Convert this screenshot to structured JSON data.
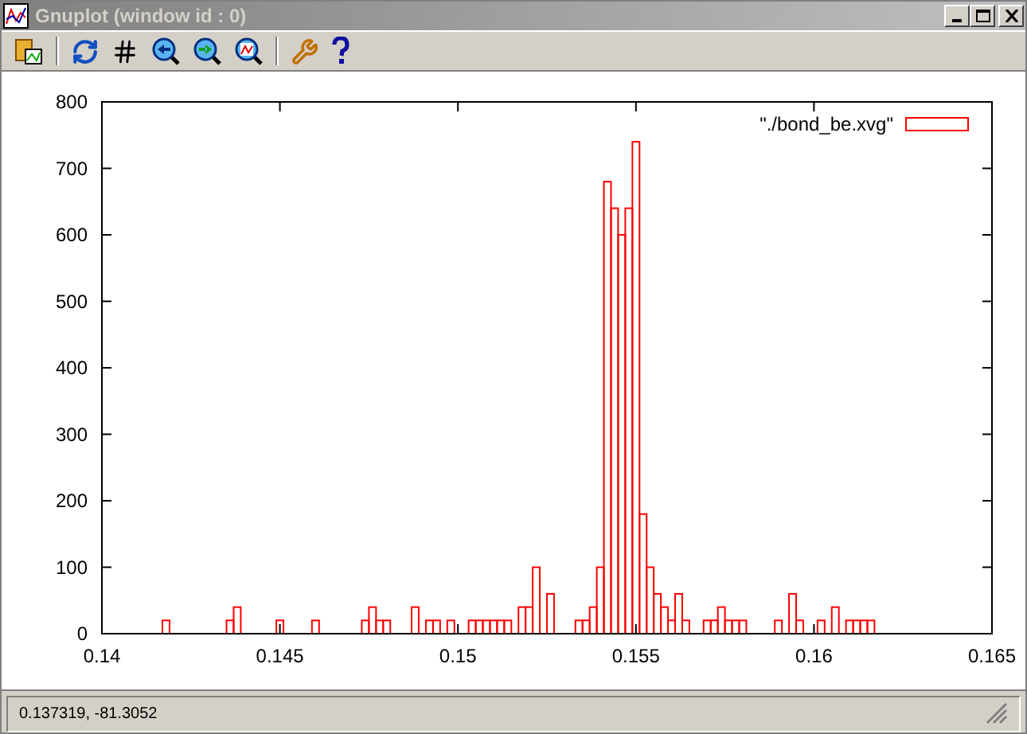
{
  "window": {
    "title": "Gnuplot (window id : 0)"
  },
  "plot": {
    "chart_data": {
      "type": "bar",
      "xlim": [
        0.14,
        0.165
      ],
      "ylim": [
        0,
        800
      ],
      "xticks": [
        0.14,
        0.145,
        0.15,
        0.155,
        0.16,
        0.165
      ],
      "yticks": [
        0,
        100,
        200,
        300,
        400,
        500,
        600,
        700,
        800
      ],
      "x": [
        0.1418,
        0.1436,
        0.1438,
        0.145,
        0.146,
        0.1474,
        0.1476,
        0.1478,
        0.148,
        0.1488,
        0.1492,
        0.1494,
        0.1498,
        0.1504,
        0.1506,
        0.1508,
        0.151,
        0.1512,
        0.1514,
        0.1518,
        0.152,
        0.1522,
        0.1526,
        0.1534,
        0.1536,
        0.1538,
        0.154,
        0.1542,
        0.1544,
        0.1546,
        0.1548,
        0.155,
        0.1552,
        0.1554,
        0.1556,
        0.1558,
        0.156,
        0.1562,
        0.1564,
        0.157,
        0.1572,
        0.1574,
        0.1576,
        0.1578,
        0.158,
        0.159,
        0.1594,
        0.1596,
        0.1602,
        0.1606,
        0.161,
        0.1612,
        0.1614,
        0.1616
      ],
      "series": [
        {
          "name": "\"./bond_be.xvg\"",
          "color": "#ff0000",
          "values": [
            20,
            20,
            40,
            20,
            20,
            20,
            40,
            20,
            20,
            40,
            20,
            20,
            20,
            20,
            20,
            20,
            20,
            20,
            20,
            40,
            40,
            100,
            60,
            20,
            20,
            40,
            100,
            680,
            640,
            600,
            640,
            740,
            180,
            100,
            60,
            40,
            20,
            60,
            20,
            20,
            20,
            40,
            20,
            20,
            20,
            20,
            60,
            20,
            20,
            40,
            20,
            20,
            20,
            20
          ]
        }
      ]
    }
  },
  "status_bar": {
    "text": "0.137319, -81.3052"
  }
}
